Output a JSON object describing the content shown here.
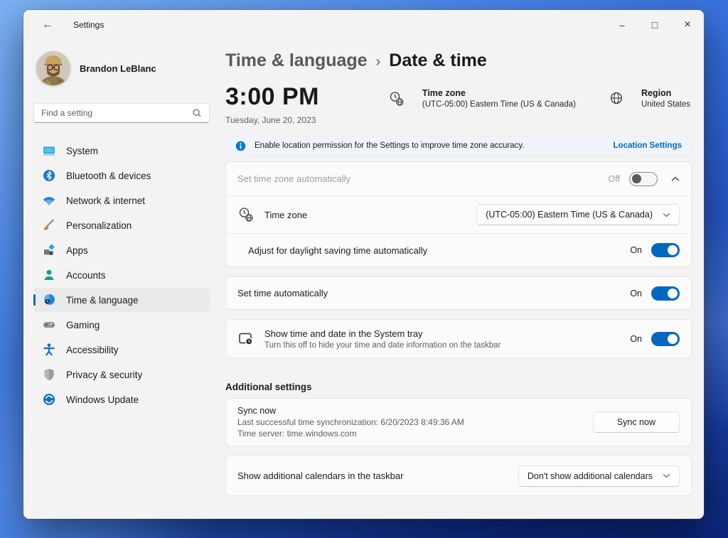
{
  "titlebar": {
    "app_title": "Settings",
    "back_icon": "←",
    "minimize_icon": "–",
    "maximize_icon": "□",
    "close_icon": "×"
  },
  "sidebar": {
    "user_name": "Brandon LeBlanc",
    "search_placeholder": "Find a setting",
    "items": [
      {
        "label": "System",
        "icon": "system-icon"
      },
      {
        "label": "Bluetooth & devices",
        "icon": "bluetooth-icon"
      },
      {
        "label": "Network & internet",
        "icon": "network-icon"
      },
      {
        "label": "Personalization",
        "icon": "personalization-brush-icon"
      },
      {
        "label": "Apps",
        "icon": "apps-icon"
      },
      {
        "label": "Accounts",
        "icon": "accounts-person-icon"
      },
      {
        "label": "Time & language",
        "icon": "clock-icon",
        "selected": true
      },
      {
        "label": "Gaming",
        "icon": "gamepad-icon"
      },
      {
        "label": "Accessibility",
        "icon": "accessibility-person-icon"
      },
      {
        "label": "Privacy & security",
        "icon": "shield-icon"
      },
      {
        "label": "Windows Update",
        "icon": "update-arrows-icon"
      }
    ]
  },
  "main": {
    "breadcrumb": {
      "parent": "Time & language",
      "separator": "›",
      "current": "Date & time"
    },
    "clock": {
      "time": "3:00 PM",
      "date": "Tuesday, June 20, 2023"
    },
    "overview": {
      "timezone_title": "Time zone",
      "timezone_value": "(UTC-05:00) Eastern Time (US & Canada)",
      "region_title": "Region",
      "region_value": "United States"
    },
    "banner": {
      "message": "Enable location permission for the Settings to improve time zone accuracy.",
      "link_label": "Location Settings"
    },
    "set_timezone_auto": {
      "label": "Set time zone automatically",
      "state_label": "Off"
    },
    "timezone_row": {
      "label": "Time zone",
      "dropdown_value": "(UTC-05:00) Eastern Time (US & Canada)"
    },
    "dst_row": {
      "label": "Adjust for daylight saving time automatically",
      "state_label": "On"
    },
    "set_time_auto": {
      "label": "Set time automatically",
      "state_label": "On"
    },
    "systray": {
      "label": "Show time and date in the System tray",
      "description": "Turn this off to hide your time and date information on the taskbar",
      "state_label": "On"
    },
    "additional": {
      "heading": "Additional settings"
    },
    "sync": {
      "title": "Sync now",
      "last_sync": "Last successful time synchronization: 6/20/2023 8:49:36 AM",
      "server": "Time server: time.windows.com",
      "button_label": "Sync now"
    },
    "calendars": {
      "label": "Show additional calendars in the taskbar",
      "dropdown_value": "Don't show additional calendars"
    }
  },
  "colors": {
    "accent": "#0067c0",
    "link": "#0067c0",
    "info_icon": "#0078d4"
  }
}
